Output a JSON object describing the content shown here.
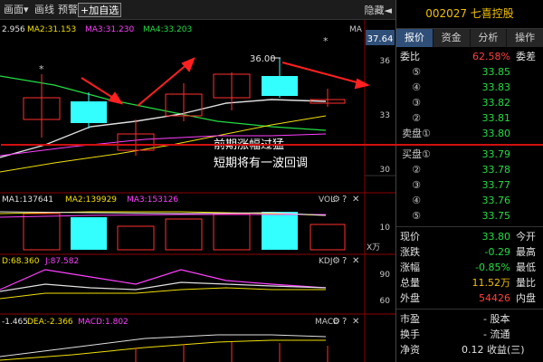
{
  "toolbar": {
    "items": [
      "画面▾",
      "画线",
      "预警",
      "+加自选"
    ],
    "right": "隐藏◄"
  },
  "indicators": {
    "ma_line": {
      "ma1": "2.956",
      "ma2": "MA2:31.153",
      "ma3": "MA3:31.230",
      "ma4": "MA4:33.203",
      "tag": "MA"
    },
    "vol_line": {
      "ma1": "MA1:137641",
      "ma2": "MA2:139929",
      "ma3": "MA3:153126",
      "tag": "VOL"
    },
    "kdj_line": {
      "d": "D:68.360",
      "j": "J:87.582",
      "tag": "KDJ"
    },
    "macd_line": {
      "diff": "-1.465",
      "dea": "DEA:-2.366",
      "macd": "MACD:1.802",
      "tag": "MACD"
    }
  },
  "price_axis": {
    "current": "37.64",
    "ticks": [
      "36",
      "33",
      "30"
    ]
  },
  "vol_axis": {
    "ticks": [
      "10"
    ],
    "unit": "X万"
  },
  "kdj_axis": {
    "ticks": [
      "90",
      "60"
    ]
  },
  "annotations": {
    "peak_price": "36.00",
    "comment_line1": "前期涨幅过猛",
    "comment_line2": "短期将有一波回调",
    "star": "*"
  },
  "panel": {
    "title": "002027 七喜控股",
    "tabs": [
      "报价",
      "资金",
      "分析",
      "操作"
    ],
    "weibi": {
      "label": "委比",
      "value": "62.58%",
      "label2": "委差"
    },
    "sell": [
      {
        "level": "⑤",
        "price": "33.85"
      },
      {
        "level": "④",
        "price": "33.83"
      },
      {
        "level": "③",
        "price": "33.82"
      },
      {
        "level": "②",
        "price": "33.81"
      },
      {
        "level": "卖盘①",
        "price": "33.80"
      }
    ],
    "buy": [
      {
        "level": "买盘①",
        "price": "33.79"
      },
      {
        "level": "②",
        "price": "33.78"
      },
      {
        "level": "③",
        "price": "33.77"
      },
      {
        "level": "④",
        "price": "33.76"
      },
      {
        "level": "⑤",
        "price": "33.75"
      }
    ],
    "stats": [
      {
        "label": "现价",
        "value": "33.80",
        "label2": "今开"
      },
      {
        "label": "涨跌",
        "value": "-0.29",
        "label2": "最高"
      },
      {
        "label": "涨幅",
        "value": "-0.85%",
        "label2": "最低"
      },
      {
        "label": "总量",
        "value": "11.52万",
        "label2": "量比"
      },
      {
        "label": "外盘",
        "value": "54426",
        "label2": "内盘"
      }
    ],
    "extra": [
      {
        "label": "市盈",
        "value": "- 股本"
      },
      {
        "label": "换手",
        "value": "- 流通"
      },
      {
        "label": "净资",
        "value": "0.12 收益(三)"
      }
    ]
  }
}
